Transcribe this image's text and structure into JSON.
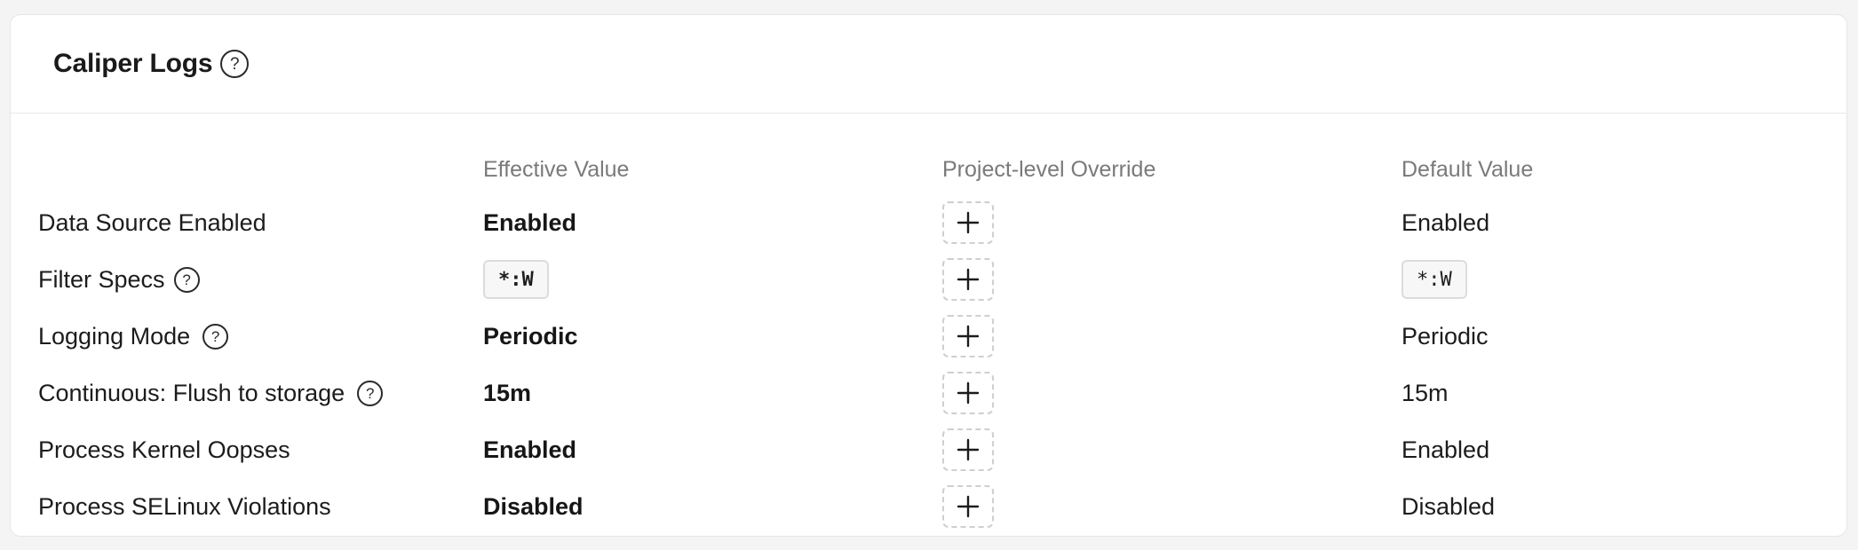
{
  "panel": {
    "title": "Caliper Logs",
    "help_glyph": "?"
  },
  "columns": {
    "setting": "",
    "effective": "Effective Value",
    "override": "Project-level Override",
    "default": "Default Value"
  },
  "rows": [
    {
      "label": "Data Source Enabled",
      "has_help": false,
      "effective": "Enabled",
      "default": "Enabled",
      "chip": false
    },
    {
      "label": "Filter Specs",
      "has_help": true,
      "effective": "*:W",
      "default": "*:W",
      "chip": true
    },
    {
      "label": "Logging Mode",
      "has_help": true,
      "effective": "Periodic",
      "default": "Periodic",
      "chip": false
    },
    {
      "label": "Continuous: Flush to storage",
      "has_help": true,
      "effective": "15m",
      "default": "15m",
      "chip": false
    },
    {
      "label": "Process Kernel Oopses",
      "has_help": false,
      "effective": "Enabled",
      "default": "Enabled",
      "chip": false
    },
    {
      "label": "Process SELinux Violations",
      "has_help": false,
      "effective": "Disabled",
      "default": "Disabled",
      "chip": false
    }
  ],
  "icons": {
    "help": "question-circle-icon",
    "override_add": "plus-icon"
  },
  "colors": {
    "background": "#f4f4f4",
    "card": "#ffffff",
    "text": "#1c1c1c",
    "muted": "#7a7a7a",
    "dashed_border": "#cfcfcf"
  }
}
